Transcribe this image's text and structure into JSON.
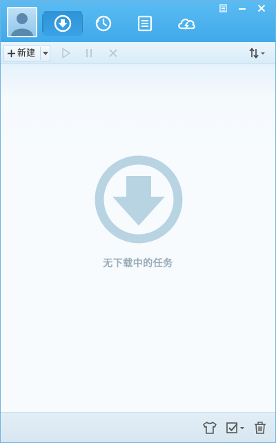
{
  "header": {
    "nav_tabs": [
      {
        "icon": "download-icon",
        "active": true
      },
      {
        "icon": "history-icon",
        "active": false
      },
      {
        "icon": "list-icon",
        "active": false
      },
      {
        "icon": "cloud-icon",
        "active": false
      }
    ],
    "window_controls": [
      "skin-icon",
      "minimize-icon",
      "close-icon"
    ]
  },
  "toolbar": {
    "new_label": "新建",
    "buttons": [
      "play-icon",
      "pause-icon",
      "delete-icon",
      "sort-icon"
    ]
  },
  "content": {
    "empty_text": "无下载中的任务"
  },
  "bottom_bar": {
    "buttons": [
      "skin-shirt-icon",
      "check-select-icon",
      "trash-icon"
    ]
  },
  "colors": {
    "header_bg": "#47b0ee",
    "empty_icon": "#b8d4e3",
    "empty_text": "#9aabb8"
  }
}
